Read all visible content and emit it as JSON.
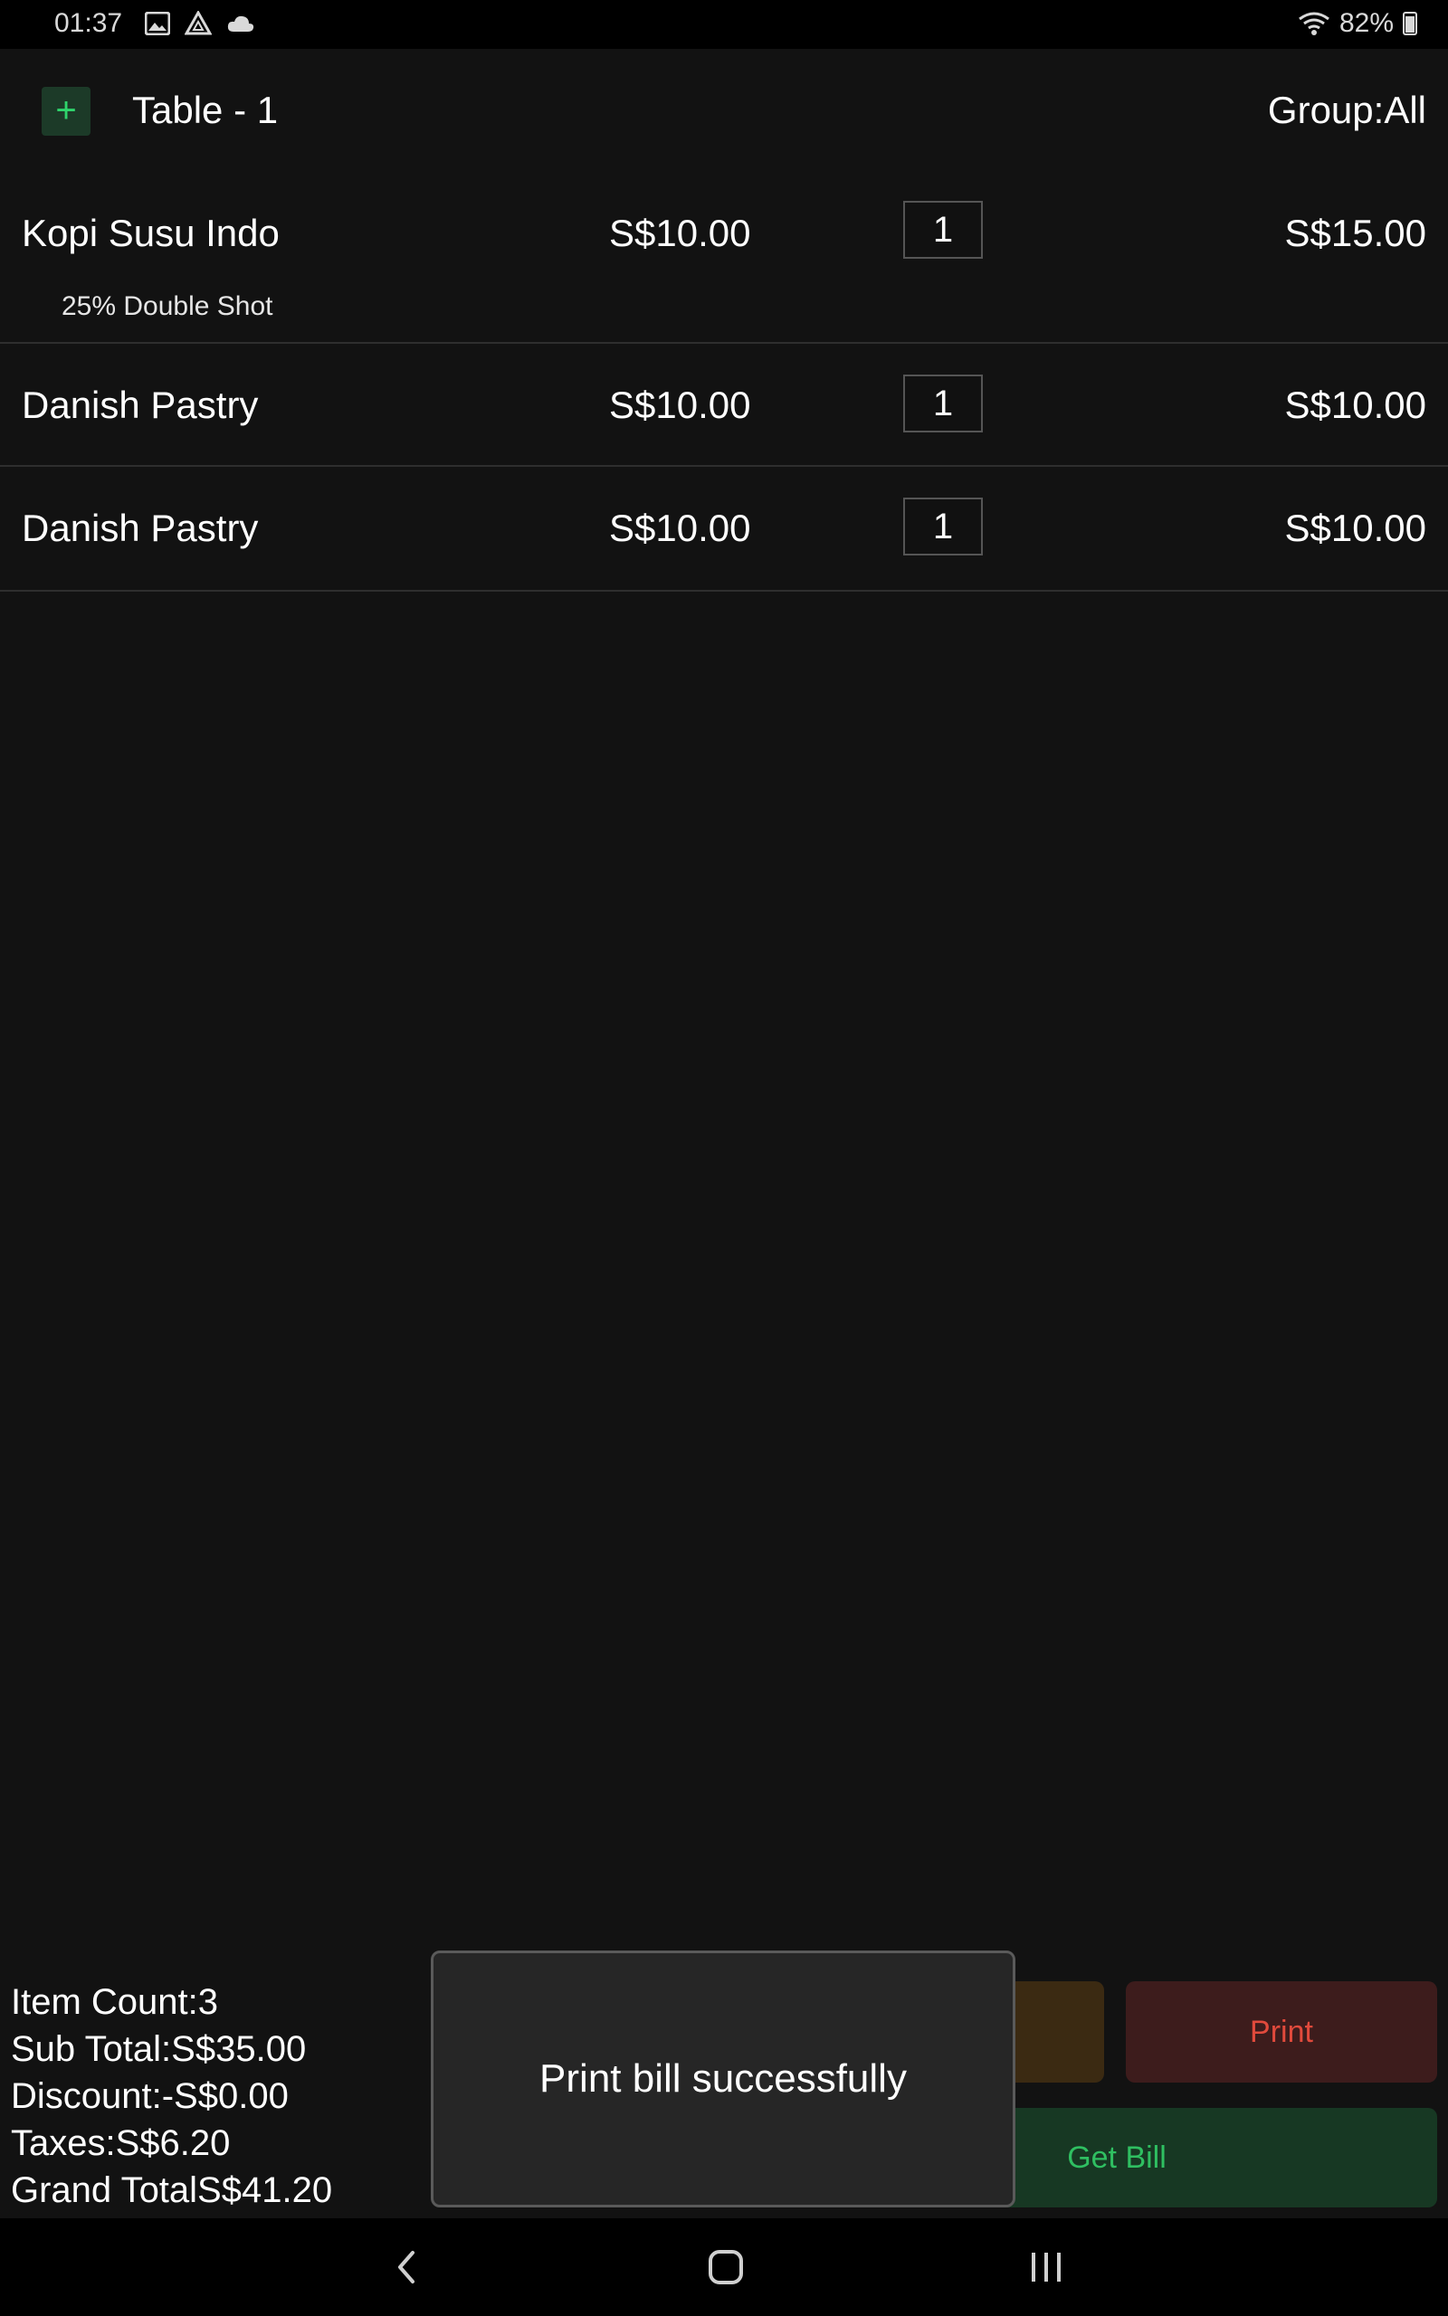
{
  "status_bar": {
    "time": "01:37",
    "battery": "82%",
    "icons": [
      "image-icon",
      "drive-icon",
      "cloud-icon",
      "wifi-icon",
      "battery-icon"
    ]
  },
  "header": {
    "add_label": "+",
    "title": "Table - 1",
    "group": "Group:All"
  },
  "items": [
    {
      "name": "Kopi Susu Indo",
      "price": "S$10.00",
      "qty": "1",
      "total": "S$15.00",
      "modifier": "25% Double Shot"
    },
    {
      "name": "Danish Pastry",
      "price": "S$10.00",
      "qty": "1",
      "total": "S$10.00"
    },
    {
      "name": "Danish Pastry",
      "price": "S$10.00",
      "qty": "1",
      "total": "S$10.00"
    }
  ],
  "summary": {
    "item_count": "Item Count:3",
    "sub_total": "Sub Total:S$35.00",
    "discount": "Discount:-S$0.00",
    "taxes": "Taxes:S$6.20",
    "grand_total": "Grand TotalS$41.20"
  },
  "buttons": {
    "print": "Print",
    "get_bill": "Get Bill"
  },
  "toast": {
    "message": "Print bill successfully"
  },
  "colors": {
    "background": "#121212",
    "accent_green": "#2fd46c",
    "print_red": "#e14a3c"
  }
}
